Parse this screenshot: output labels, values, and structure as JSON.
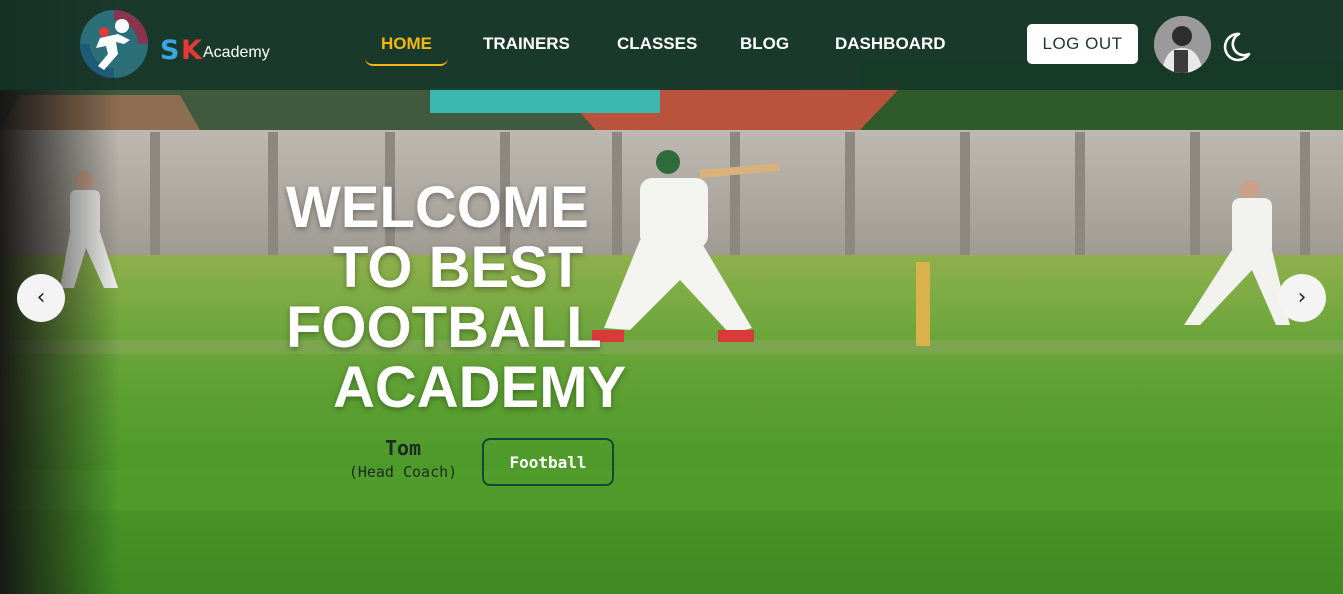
{
  "brand": {
    "letter_s": "S",
    "letter_k": "K",
    "name": "Academy",
    "colors": {
      "s": "#3aa6e0",
      "k": "#e53935",
      "ring": "#8a3550"
    }
  },
  "nav": {
    "items": [
      {
        "label": "HOME",
        "active": true
      },
      {
        "label": "TRAINERS",
        "active": false
      },
      {
        "label": "CLASSES",
        "active": false
      },
      {
        "label": "BLOG",
        "active": false
      },
      {
        "label": "DASHBOARD",
        "active": false
      }
    ],
    "active_color": "#f2b713"
  },
  "header": {
    "logout_label": "LOG OUT",
    "avatar_icon": "user-avatar",
    "theme_icon": "moon-icon"
  },
  "hero": {
    "headline": [
      "WELCOME",
      "TO BEST",
      "FOOTBALL",
      "ACADEMY"
    ],
    "coach_name": "Tom",
    "coach_role": "(Head Coach)",
    "category_label": "Football",
    "prev_arrow": "‹",
    "next_arrow": "›"
  },
  "colors": {
    "navbar_bg": "#14342a",
    "grass": "#4f9a2a",
    "button_border": "#0e4a37"
  }
}
